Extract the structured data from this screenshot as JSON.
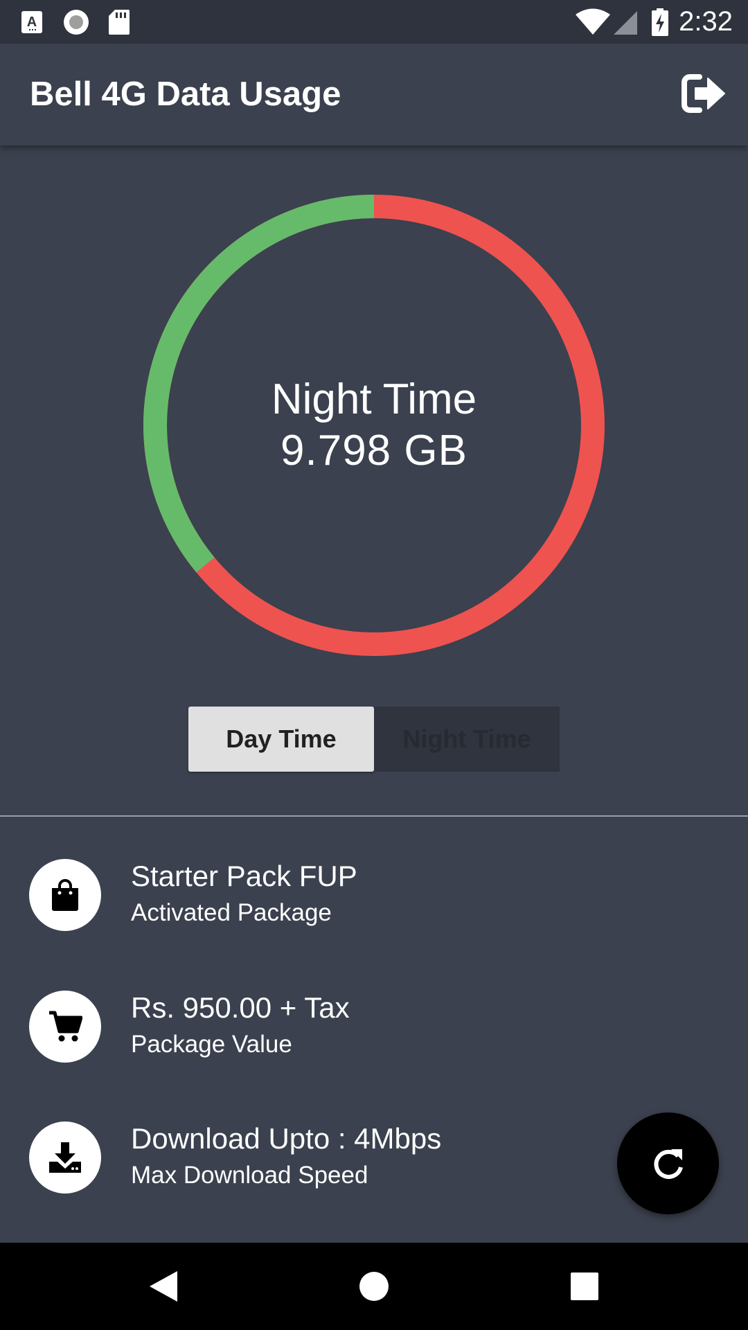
{
  "status_bar": {
    "time": "2:32",
    "icons": [
      "a-notification-icon",
      "record-icon",
      "sd-card-icon",
      "wifi-icon",
      "signal-icon",
      "battery-charging-icon"
    ]
  },
  "app_bar": {
    "title": "Bell 4G Data Usage",
    "action_icon": "logout-icon"
  },
  "gauge": {
    "label": "Night Time",
    "value": "9.798 GB",
    "green_fraction": 0.36,
    "colors": {
      "used": "#ef5350",
      "remaining": "#66bb6a"
    }
  },
  "toggle": {
    "day_label": "Day Time",
    "night_label": "Night Time",
    "selected": "day"
  },
  "info": [
    {
      "title": "Starter Pack FUP",
      "subtitle": "Activated Package",
      "icon": "shopping-bag-icon"
    },
    {
      "title": "Rs. 950.00 + Tax",
      "subtitle": "Package Value",
      "icon": "cart-icon"
    },
    {
      "title": "Download Upto : 4Mbps",
      "subtitle": "Max Download Speed",
      "icon": "download-icon"
    }
  ],
  "fab": {
    "icon": "refresh-icon"
  },
  "nav_bar": {
    "icons": [
      "back-icon",
      "home-icon",
      "recents-icon"
    ]
  }
}
